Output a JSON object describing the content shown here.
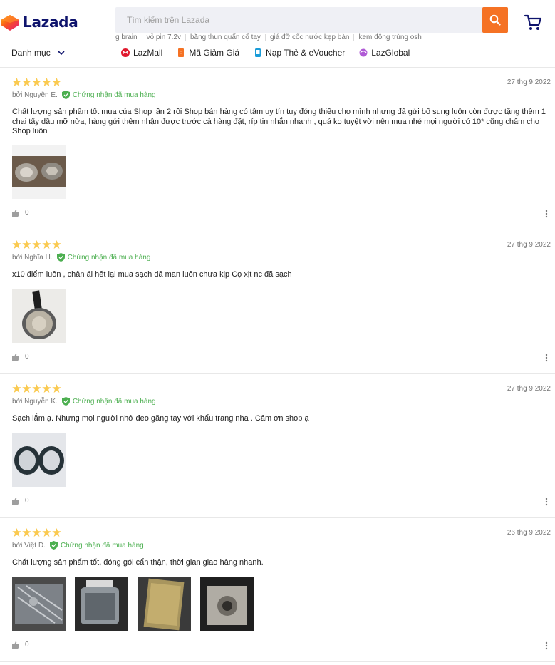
{
  "header": {
    "logo_text": "Lazada",
    "search_placeholder": "Tìm kiếm trên Lazada",
    "suggestions": [
      "g brain",
      "vỏ pin 7.2v",
      "băng thun quấn cổ tay",
      "giá đỡ cốc nước kẹp bàn",
      "kem đông trùng oshiya"
    ],
    "category_label": "Danh mục",
    "quicknav": [
      {
        "label": "LazMall",
        "icon": "lazmall-icon",
        "color": "#e0182d"
      },
      {
        "label": "Mã Giảm Giá",
        "icon": "voucher-icon",
        "color": "#f57224"
      },
      {
        "label": "Nạp Thẻ & eVoucher",
        "icon": "topup-icon",
        "color": "#1a9cd8"
      },
      {
        "label": "LazGlobal",
        "icon": "lazglobal-icon",
        "color": "#9c27b0"
      }
    ]
  },
  "colors": {
    "accent": "#f57224",
    "star": "#faca51",
    "verified": "#4caf50",
    "brand_text": "#0f146d"
  },
  "reviews": [
    {
      "rating": 5,
      "date": "27 thg 9 2022",
      "author": "bởi Nguyễn E.",
      "verified": "Chứng nhận đã mua hàng",
      "content": "Chất lượng sản phẩm tốt mua của Shop lần 2 rồi Shop bán hàng có tâm uy tín tuy đóng thiếu cho mình nhưng đã gửi bổ sung luôn còn được tặng thêm 1 chai tẩy dầu mỡ nữa, hàng gửi thêm nhận được trước cả hàng đặt, ríp tin nhắn nhanh , quá ko tuyệt vời nên mua nhé mọi người có 10* cũng chấm cho Shop luôn",
      "photos": 1,
      "likes": "0"
    },
    {
      "rating": 5,
      "date": "27 thg 9 2022",
      "author": "bởi Nghĩa H.",
      "verified": "Chứng nhận đã mua hàng",
      "content": "x10 điểm luôn , chân ái hết lại mua sạch dã man luôn chưa kịp Cọ xịt nc đã sạch",
      "photos": 1,
      "likes": "0"
    },
    {
      "rating": 5,
      "date": "27 thg 9 2022",
      "author": "bởi Nguyễn K.",
      "verified": "Chứng nhận đã mua hàng",
      "content": "Sạch lắm ạ. Nhưng mọi người nhớ đeo găng tay với khẩu trang nha . Cảm ơn shop ạ",
      "photos": 1,
      "likes": "0"
    },
    {
      "rating": 5,
      "date": "26 thg 9 2022",
      "author": "bởi Việt D.",
      "verified": "Chứng nhận đã mua hàng",
      "content": "Chất lượng sản phẩm tốt, đóng gói cẩn thận, thời gian giao hàng nhanh.",
      "photos": 4,
      "likes": "0"
    }
  ]
}
